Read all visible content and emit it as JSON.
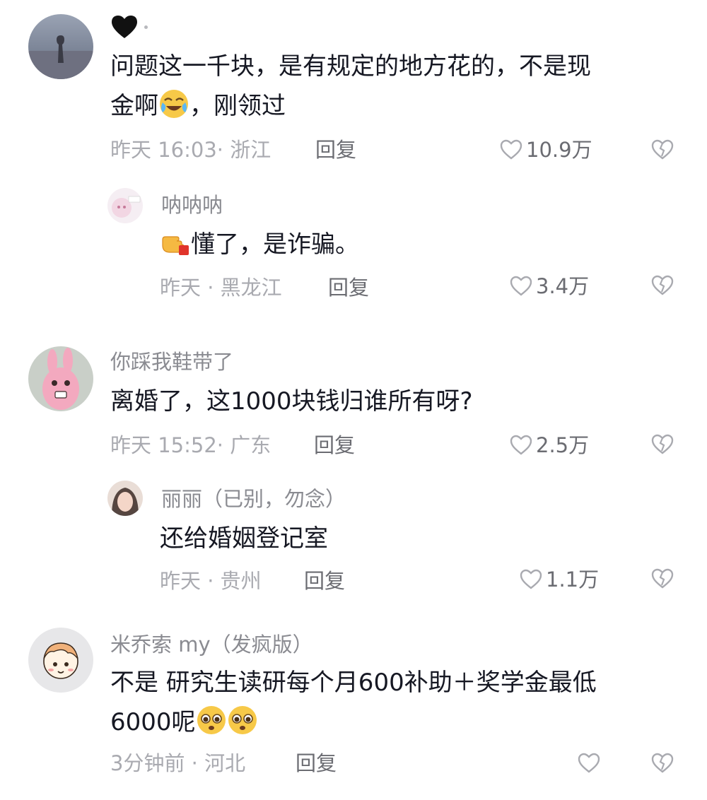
{
  "comments": [
    {
      "username": "",
      "content_lines": [
        "问题这一千块，是有规定的地方花的，不是现",
        "金啊",
        "，刚领过"
      ],
      "time_location": "昨天 16:03· 浙江",
      "reply_label": "回复",
      "likes": "10.9万",
      "top_mark_icon": "black-heart-icon",
      "emoji": "crying-laughing-emoji"
    },
    {
      "username": "呐呐呐",
      "content": "懂了，是诈骗。",
      "time_location": "昨天 · 黑龙江",
      "reply_label": "回复",
      "likes": "3.4万",
      "emoji": "pointing-hand-emoji"
    },
    {
      "username": "你踩我鞋带了",
      "content": "离婚了，这1000块钱归谁所有呀?",
      "time_location": "昨天 15:52· 广东",
      "reply_label": "回复",
      "likes": "2.5万"
    },
    {
      "username": "丽丽（已别，勿念）",
      "content": "还给婚姻登记室",
      "time_location": "昨天 · 贵州",
      "reply_label": "回复",
      "likes": "1.1万"
    },
    {
      "username": "米乔索 my（发疯版）",
      "content_lines": [
        "不是 研究生读研每个月600补助＋奖学金最低",
        "6000呢"
      ],
      "time_location": "3分钟前 · 河北",
      "reply_label": "回复",
      "likes": "",
      "emoji": "pleading-face-emoji"
    }
  ],
  "colors": {
    "text": "#161823",
    "meta": "#a9aab0",
    "username": "#8a8b91",
    "action": "#6b6c72"
  }
}
